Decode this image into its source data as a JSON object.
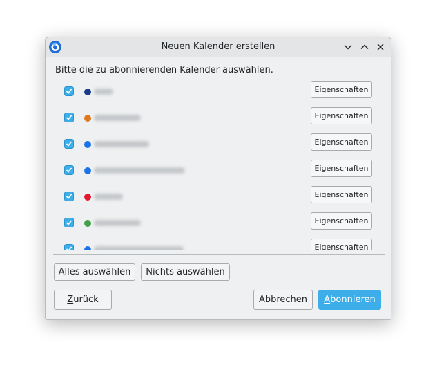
{
  "window": {
    "title": "Neuen Kalender erstellen",
    "controls": [
      "chevron-down-icon",
      "chevron-up-icon",
      "close-icon"
    ]
  },
  "intro_text": "Bitte die zu abonnierenden Kalender auswählen.",
  "calendars": [
    {
      "checked": true,
      "color": "#1a3b8c",
      "name_visible": false,
      "properties_label": "Eigenschaften"
    },
    {
      "checked": true,
      "color": "#e07a1f",
      "name_visible": false,
      "properties_label": "Eigenschaften"
    },
    {
      "checked": true,
      "color": "#1a73e8",
      "name_visible": false,
      "properties_label": "Eigenschaften"
    },
    {
      "checked": true,
      "color": "#1a73e8",
      "name_visible": false,
      "properties_label": "Eigenschaften"
    },
    {
      "checked": true,
      "color": "#e3172d",
      "name_visible": false,
      "properties_label": "Eigenschaften"
    },
    {
      "checked": true,
      "color": "#43a047",
      "name_visible": false,
      "properties_label": "Eigenschaften"
    },
    {
      "checked": true,
      "color": "#1a73e8",
      "name_visible": false,
      "properties_label": "Eigenschaften"
    }
  ],
  "buttons": {
    "select_all": "Alles auswählen",
    "select_none": "Nichts auswählen",
    "back_mnemonic": "Z",
    "back_rest": "urück",
    "cancel": "Abbrechen",
    "subscribe_mnemonic": "A",
    "subscribe_rest": "bonnieren"
  },
  "colors": {
    "accent": "#3daee9",
    "window_bg": "#eff0f1"
  }
}
